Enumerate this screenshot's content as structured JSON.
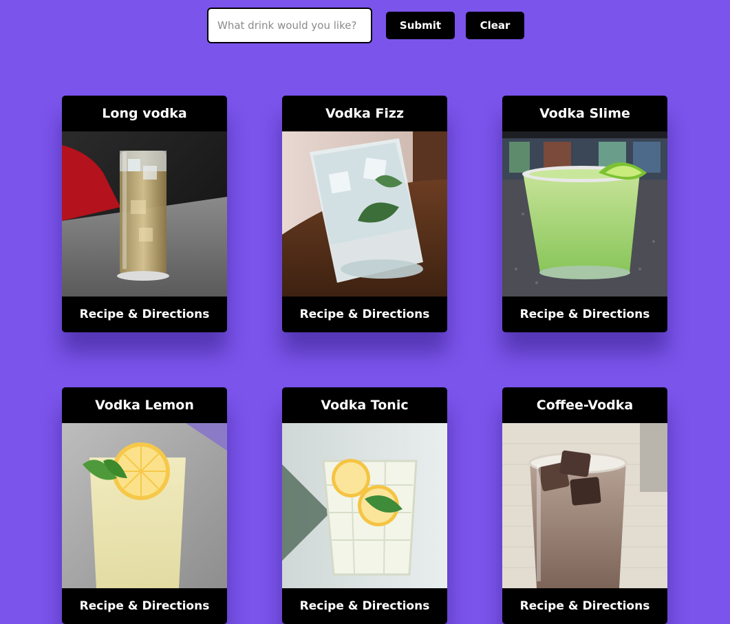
{
  "search": {
    "placeholder": "What drink would you like?",
    "value": "",
    "submit_label": "Submit",
    "clear_label": "Clear"
  },
  "drinks": [
    {
      "name": "Long vodka",
      "link_label": "Recipe & Directions",
      "image": "highball-glass-photo"
    },
    {
      "name": "Vodka Fizz",
      "link_label": "Recipe & Directions",
      "image": "mint-fizz-glass-photo"
    },
    {
      "name": "Vodka Slime",
      "link_label": "Recipe & Directions",
      "image": "lime-rimmed-glass-photo"
    },
    {
      "name": "Vodka Lemon",
      "link_label": "Recipe & Directions",
      "image": "lemon-glass-photo"
    },
    {
      "name": "Vodka Tonic",
      "link_label": "Recipe & Directions",
      "image": "tonic-glass-photo"
    },
    {
      "name": "Coffee-Vodka",
      "link_label": "Recipe & Directions",
      "image": "iced-coffee-glass-photo"
    }
  ],
  "colors": {
    "background": "#7b54ec",
    "card": "#000000",
    "text": "#ffffff"
  }
}
